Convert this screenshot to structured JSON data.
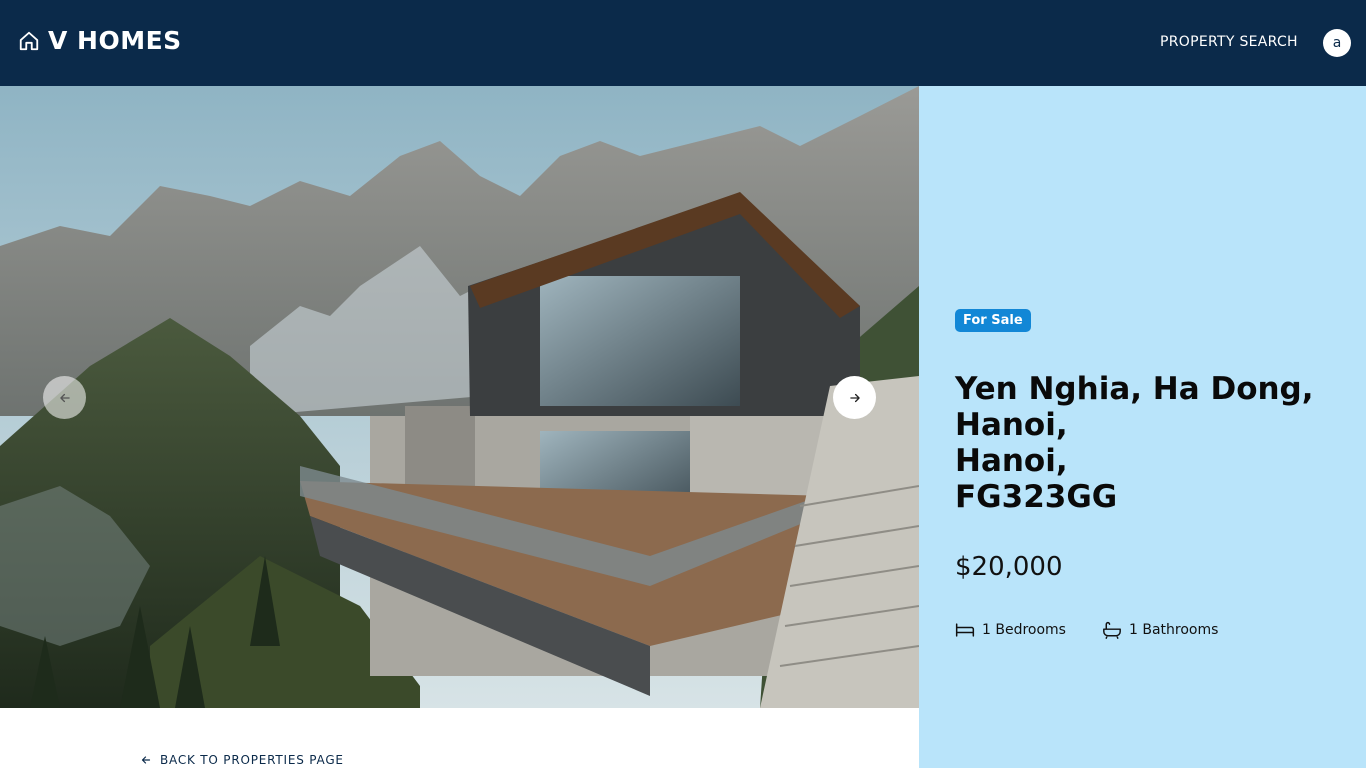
{
  "header": {
    "brand": "V HOMES",
    "nav_link": "PROPERTY SEARCH",
    "avatar_initial": "a"
  },
  "listing": {
    "status_badge": "For Sale",
    "address_lines": [
      "Yen Nghia, Ha Dong,",
      "Hanoi,",
      "Hanoi,",
      "FG323GG"
    ],
    "price": "$20,000",
    "bedrooms": "1 Bedrooms",
    "bathrooms": "1 Bathrooms"
  },
  "footer": {
    "back_link": "BACK TO PROPERTIES PAGE"
  },
  "colors": {
    "nav_bg": "#0b2a4a",
    "panel_bg": "#b9e4fa",
    "badge_bg": "#1287d6"
  }
}
